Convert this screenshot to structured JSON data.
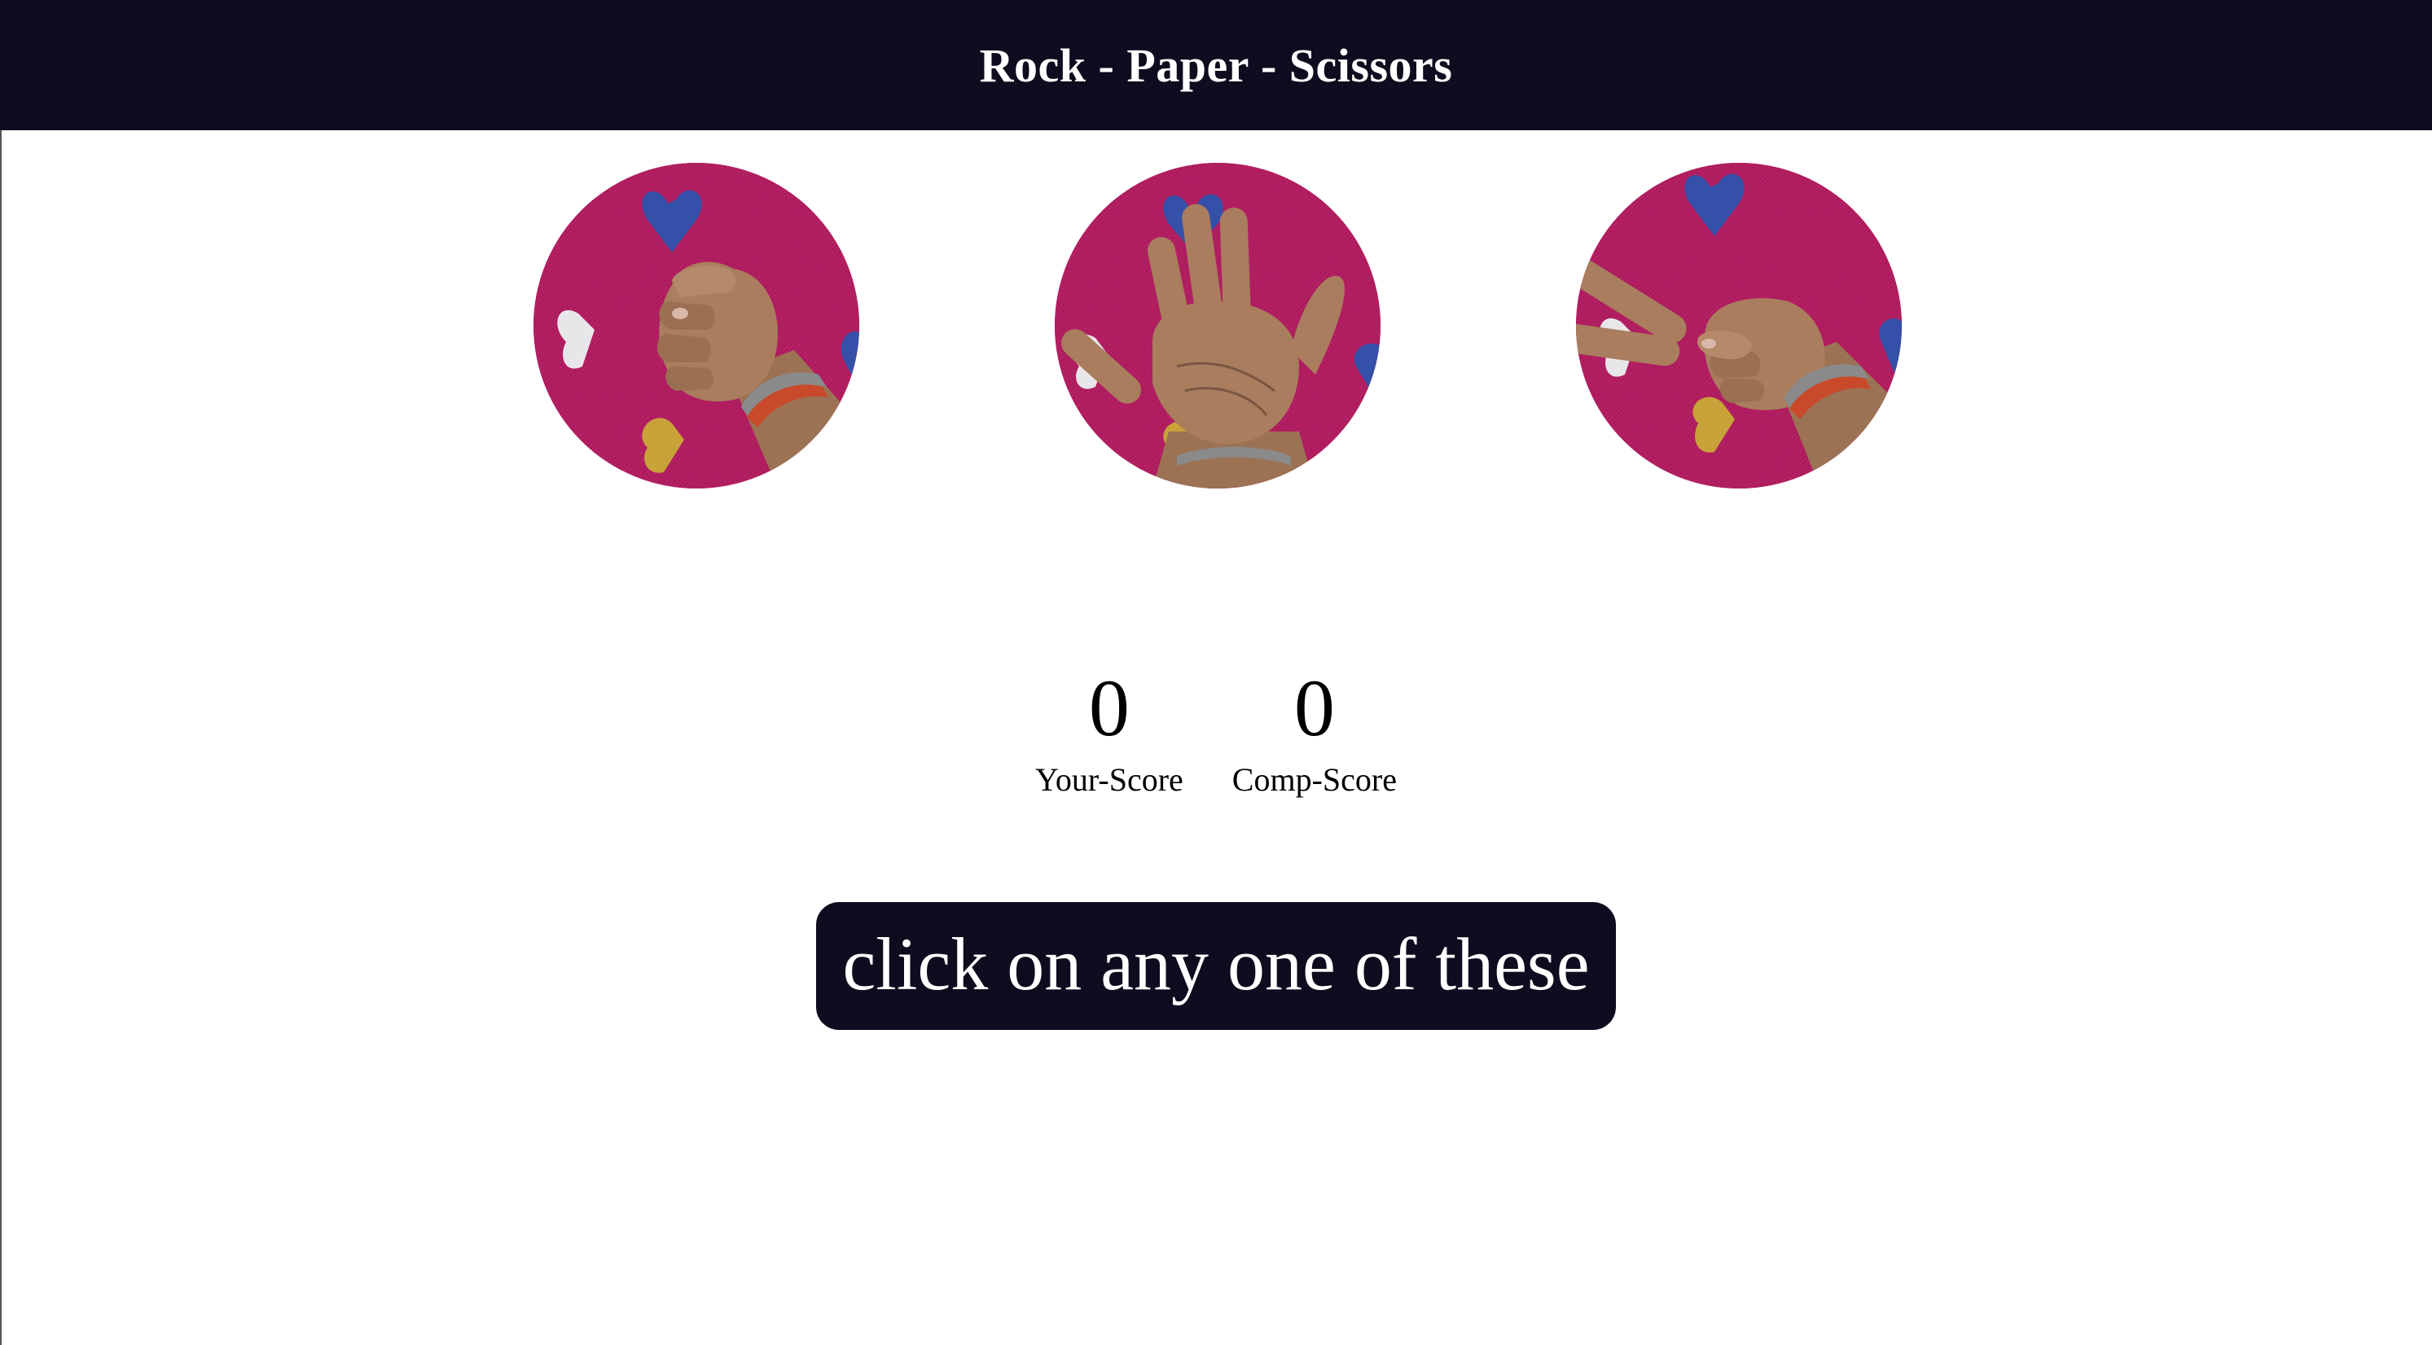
{
  "header": {
    "title": "Rock - Paper - Scissors"
  },
  "choices": [
    {
      "id": "rock",
      "icon": "fist-hand-photo"
    },
    {
      "id": "paper",
      "icon": "open-palm-hand-photo"
    },
    {
      "id": "scissors",
      "icon": "v-sign-hand-photo"
    }
  ],
  "scores": {
    "user": {
      "value": "0",
      "label": "Your-Score"
    },
    "comp": {
      "value": "0",
      "label": "Comp-Score"
    }
  },
  "message": {
    "text": "click on any one of these"
  },
  "colors": {
    "header_bg": "#0e0d1f",
    "message_bg": "#0e0d1f",
    "cloth": "#b51f63",
    "skin": "#a97d5e"
  }
}
